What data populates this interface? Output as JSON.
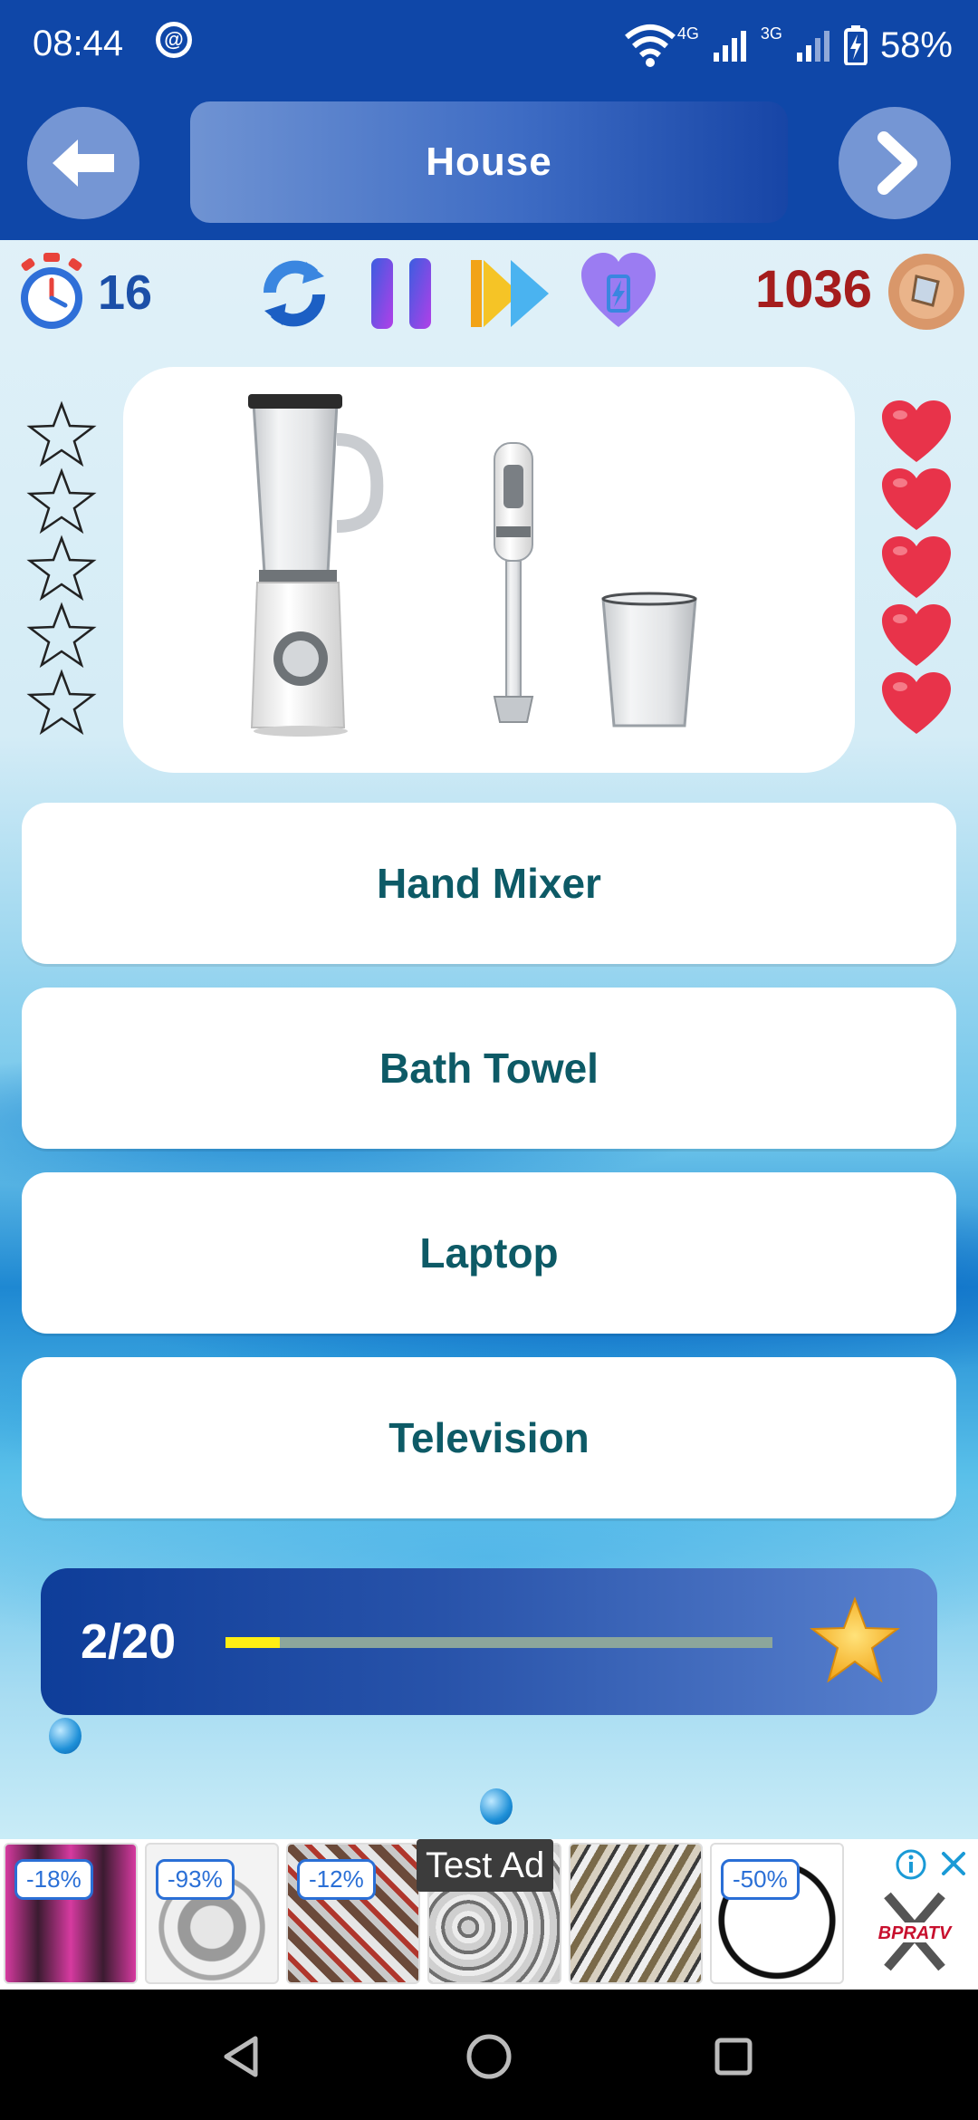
{
  "status_bar": {
    "time": "08:44",
    "network_4g": "4G",
    "network_3g": "3G",
    "battery": "58%"
  },
  "header": {
    "title": "House",
    "back_icon": "arrow-left-icon",
    "next_icon": "chevron-right-icon"
  },
  "toolbar": {
    "timer_value": "16",
    "coins_value": "1036",
    "icons": [
      "stopwatch-icon",
      "refresh-icon",
      "pause-icon",
      "skip-icon",
      "heart-battery-icon",
      "coin-icon"
    ]
  },
  "stars": {
    "total": 5,
    "filled": 0
  },
  "lives": {
    "total": 5,
    "remaining": 5
  },
  "question_image": "blender-and-hand-mixer",
  "answers": [
    {
      "label": "Hand Mixer"
    },
    {
      "label": "Bath Towel"
    },
    {
      "label": "Laptop"
    },
    {
      "label": "Television"
    }
  ],
  "progress": {
    "text": "2/20",
    "fraction": 0.1
  },
  "ad": {
    "test_label": "Test Ad",
    "badges": [
      "-18%",
      "-93%",
      "-12%",
      "-50%"
    ],
    "brand_logo": "BPRATV"
  },
  "colors": {
    "header_bg": "#0f47a8",
    "answer_text": "#0d5a66",
    "coins_text": "#a51d1d",
    "progress_fill": "#ffef13"
  }
}
